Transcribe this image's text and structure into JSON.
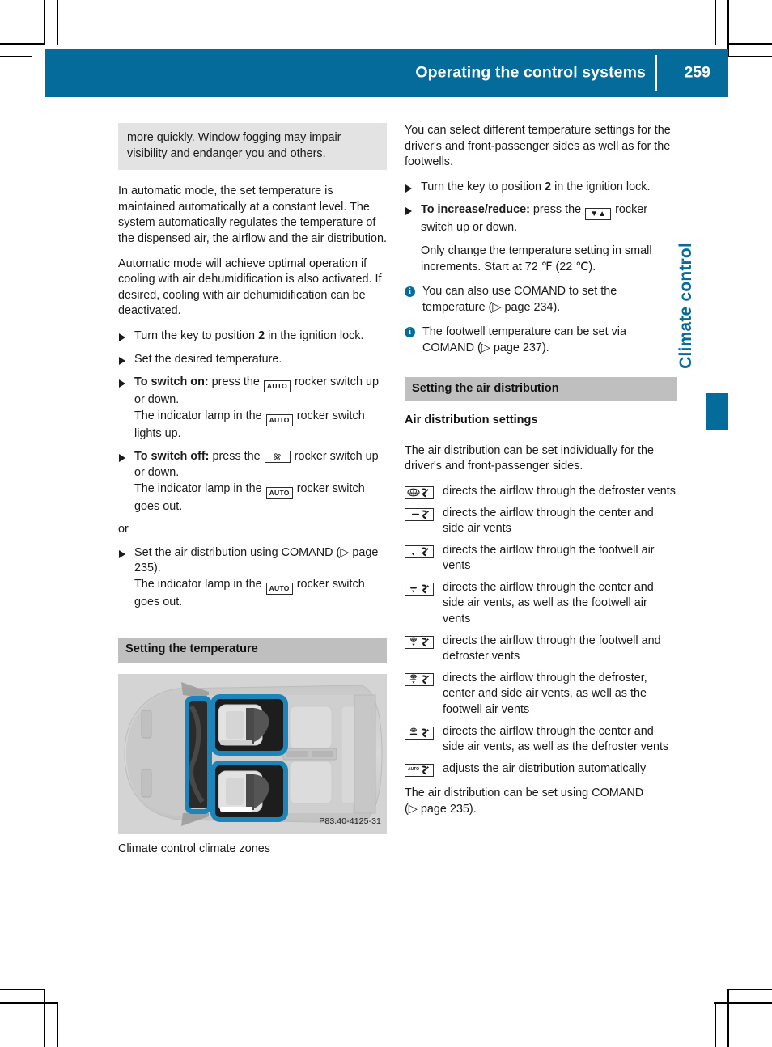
{
  "header": {
    "title": "Operating the control systems",
    "page_number": "259"
  },
  "side_tab": {
    "label": "Climate control"
  },
  "left_column": {
    "note_box": "more quickly. Window fogging may impair visibility and endanger you and others.",
    "para_1": "In automatic mode, the set temperature is maintained automatically at a constant level. The system automatically regulates the temperature of the dispensed air, the airflow and the air distribution.",
    "para_2": "Automatic mode will achieve optimal operation if cooling with air dehumidification is also activated. If desired, cooling with air dehumidification can be deactivated.",
    "step_1_a": "Turn the key to position ",
    "step_1_bold": "2",
    "step_1_b": " in the ignition lock.",
    "step_2": "Set the desired temperature.",
    "step_3_bold": "To switch on:",
    "step_3_a": " press the ",
    "step_3_glyph": "AUTO",
    "step_3_b": " rocker switch up or down.",
    "step_3_sub_a": "The indicator lamp in the ",
    "step_3_sub_glyph": "AUTO",
    "step_3_sub_b": " rocker switch lights up.",
    "step_4_bold": "To switch off:",
    "step_4_a": " press the ",
    "step_4_glyph": "fan-icon",
    "step_4_b": " rocker switch up or down.",
    "step_4_sub_a": "The indicator lamp in the ",
    "step_4_sub_glyph": "AUTO",
    "step_4_sub_b": " rocker switch goes out.",
    "or_label": "or",
    "step_5_a": "Set the air distribution using COMAND (",
    "step_5_ref": "page 235",
    "step_5_b": ").",
    "step_5_sub_a": "The indicator lamp in the ",
    "step_5_sub_glyph": "AUTO",
    "step_5_sub_b": " rocker switch goes out.",
    "section_heading": "Setting the temperature",
    "figure_code": "P83.40-4125-31",
    "figure_caption": "Climate control climate zones"
  },
  "right_column": {
    "para_1": "You can select different temperature settings for the driver's and front-passenger sides as well as for the footwells.",
    "step_1_a": "Turn the key to position ",
    "step_1_bold": "2",
    "step_1_b": " in the ignition lock.",
    "step_2_bold": "To increase/reduce:",
    "step_2_a": " press the ",
    "step_2_glyph": "down-up-arrows-icon",
    "step_2_b": " rocker switch up or down.",
    "step_2_sub": "Only change the temperature setting in small increments. Start at 72 ℉ (22 ℃).",
    "info_1_a": "You can also use COMAND to set the temperature (",
    "info_1_ref": "page 234",
    "info_1_b": ").",
    "info_2_a": "The footwell temperature can be set via COMAND (",
    "info_2_ref": "page 237",
    "info_2_b": ").",
    "section_heading": "Setting the air distribution",
    "sub_heading": "Air distribution settings",
    "para_2": "The air distribution can be set individually for the driver's and front-passenger sides.",
    "air_distribution": [
      {
        "icon": "defroster-vents-icon",
        "text": "directs the airflow through the defroster vents"
      },
      {
        "icon": "center-side-vents-icon",
        "text": "directs the airflow through the center and side air vents"
      },
      {
        "icon": "footwell-vents-icon",
        "text": "directs the airflow through the footwell air vents"
      },
      {
        "icon": "center-side-footwell-vents-icon",
        "text": "directs the airflow through the center and side air vents, as well as the footwell air vents"
      },
      {
        "icon": "footwell-defroster-vents-icon",
        "text": "directs the airflow through the footwell and defroster vents"
      },
      {
        "icon": "defroster-center-side-footwell-vents-icon",
        "text": "directs the airflow through the defroster, center and side air vents, as well as the footwell air vents"
      },
      {
        "icon": "center-side-defroster-vents-icon",
        "text": "directs the airflow through the center and side air vents, as well as the defroster vents"
      },
      {
        "icon": "auto-air-distribution-icon",
        "text": "adjusts the air distribution automatically"
      }
    ],
    "closing_a": "The air distribution can be set using COMAND (",
    "closing_ref": "page 235",
    "closing_b": ")."
  },
  "colors": {
    "brand_blue": "#056b9b",
    "note_grey": "#e3e3e3",
    "section_grey": "#bfbfbf",
    "figure_highlight": "#1b84b8"
  }
}
